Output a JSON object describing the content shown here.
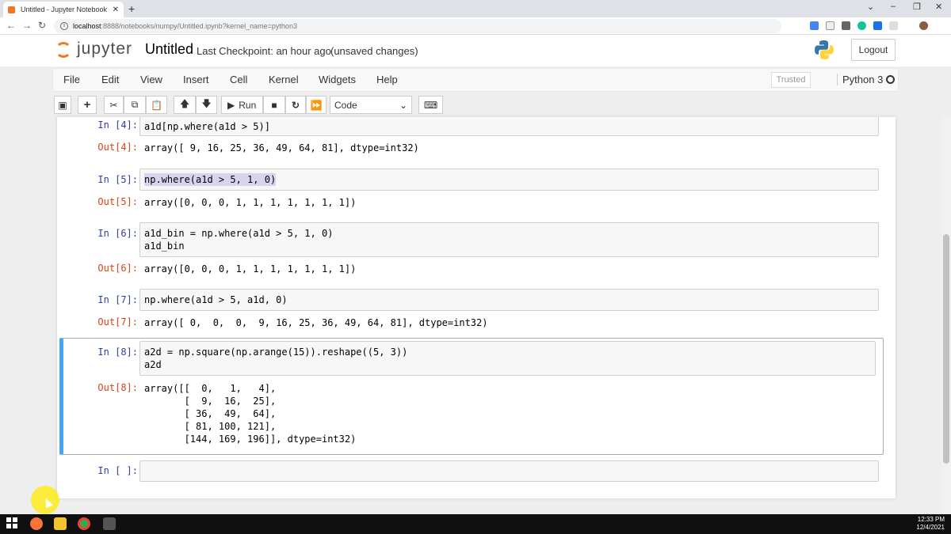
{
  "browser": {
    "tab_title": "Untitled - Jupyter Notebook",
    "tab_close": "✕",
    "new_tab": "+",
    "url_host": "localhost",
    "url_path": ":8888/notebooks/numpy/Untitled.ipynb?kernel_name=python3",
    "window_controls": [
      "⌄",
      "–",
      "❐",
      "✕"
    ]
  },
  "header": {
    "logo_text": "jupyter",
    "notebook_name": "Untitled",
    "checkpoint": "Last Checkpoint: an hour ago",
    "unsaved": "(unsaved changes)",
    "logout": "Logout"
  },
  "menubar": {
    "items": [
      "File",
      "Edit",
      "View",
      "Insert",
      "Cell",
      "Kernel",
      "Widgets",
      "Help"
    ],
    "trusted": "Trusted",
    "kernel": "Python 3"
  },
  "toolbar": {
    "run_label": "Run",
    "cell_type": "Code"
  },
  "cells": [
    {
      "in_prompt": "In [4]:",
      "code": "a1d[np.where(a1d > 5)]",
      "out_prompt": "Out[4]:",
      "output": "array([ 9, 16, 25, 36, 49, 64, 81], dtype=int32)"
    },
    {
      "in_prompt": "In [5]:",
      "code": "np.where(a1d > 5, 1, 0)",
      "out_prompt": "Out[5]:",
      "output": "array([0, 0, 0, 1, 1, 1, 1, 1, 1, 1])"
    },
    {
      "in_prompt": "In [6]:",
      "code": "a1d_bin = np.where(a1d > 5, 1, 0)\na1d_bin",
      "out_prompt": "Out[6]:",
      "output": "array([0, 0, 0, 1, 1, 1, 1, 1, 1, 1])"
    },
    {
      "in_prompt": "In [7]:",
      "code": "np.where(a1d > 5, a1d, 0)",
      "out_prompt": "Out[7]:",
      "output": "array([ 0,  0,  0,  9, 16, 25, 36, 49, 64, 81], dtype=int32)"
    },
    {
      "in_prompt": "In [8]:",
      "code": "a2d = np.square(np.arange(15)).reshape((5, 3))\na2d",
      "out_prompt": "Out[8]:",
      "output": "array([[  0,   1,   4],\n       [  9,  16,  25],\n       [ 36,  49,  64],\n       [ 81, 100, 121],\n       [144, 169, 196]], dtype=int32)"
    },
    {
      "in_prompt": "In [ ]:",
      "code": ""
    }
  ],
  "taskbar": {
    "time": "12:33 PM",
    "date": "12/4/2021"
  }
}
